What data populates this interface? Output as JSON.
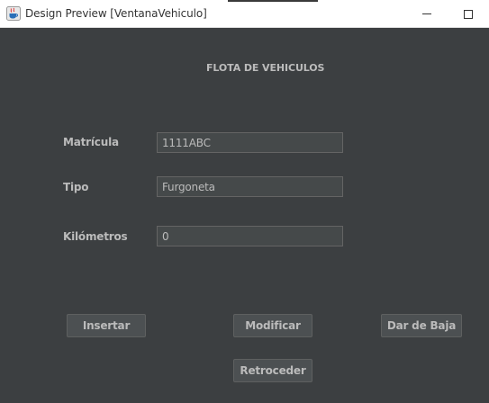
{
  "window": {
    "title": "Design Preview [VentanaVehiculo]",
    "app_icon": "java-coffee-icon",
    "controls": [
      "minimize-icon",
      "maximize-icon"
    ]
  },
  "form": {
    "heading": "FLOTA DE VEHICULOS",
    "fields": {
      "matricula": {
        "label": "Matrícula",
        "value": "1111ABC"
      },
      "tipo": {
        "label": "Tipo",
        "value": "Furgoneta"
      },
      "kilometros": {
        "label": "Kilómetros",
        "value": "0"
      }
    }
  },
  "buttons": {
    "insertar": "Insertar",
    "modificar": "Modificar",
    "dar_de_baja": "Dar de Baja",
    "retroceder": "Retroceder"
  },
  "colors": {
    "background": "#3c3f41",
    "text": "#bbbbbb",
    "field_bg": "#45494a",
    "button_bg": "#4c5052"
  }
}
